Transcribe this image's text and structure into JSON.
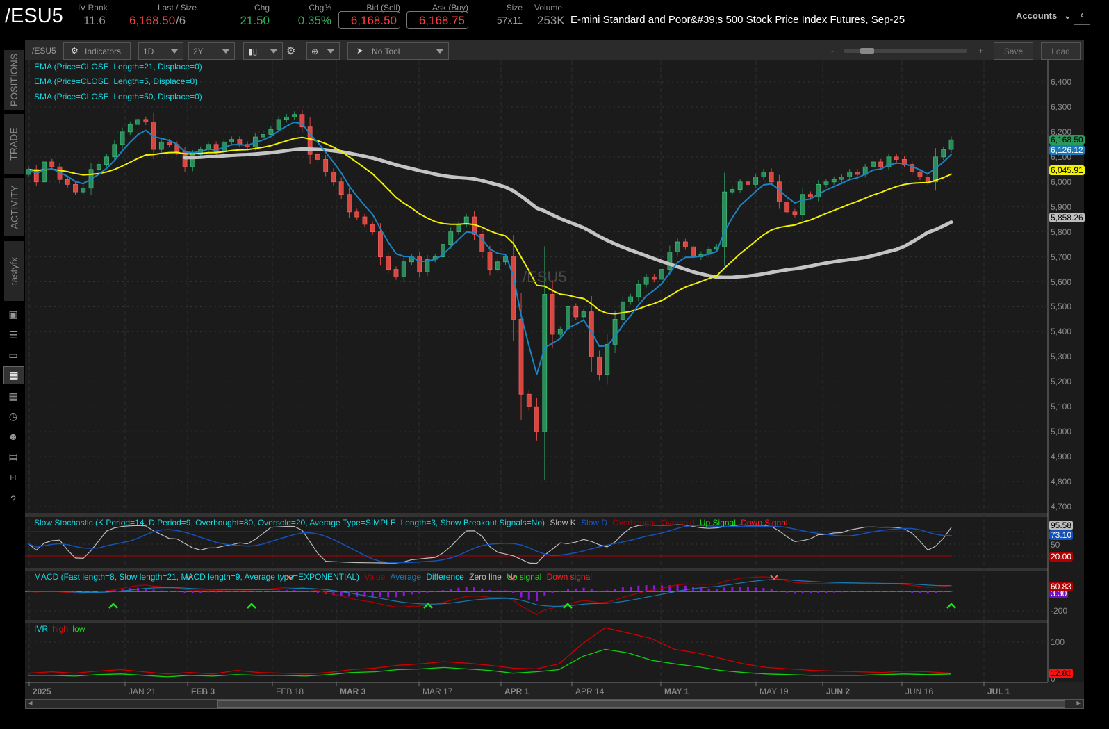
{
  "header": {
    "symbol": "/ESU5",
    "iv_rank": {
      "label": "IV Rank",
      "value": "11.6"
    },
    "last_size": {
      "label": "Last / Size",
      "last": "6,168.50",
      "size": "/6"
    },
    "chg": {
      "label": "Chg",
      "value": "21.50"
    },
    "chg_pct": {
      "label": "Chg%",
      "value": "0.35%"
    },
    "bid": {
      "label": "Bid (Sell)",
      "value": "6,168.50"
    },
    "ask": {
      "label": "Ask (Buy)",
      "value": "6,168.75"
    },
    "size": {
      "label": "Size",
      "value": "57x11"
    },
    "volume": {
      "label": "Volume",
      "value": "253K"
    },
    "description": "E-mini Standard and Poor&#39;s 500 Stock Price Index Futures, Sep-25",
    "accounts": "Accounts"
  },
  "toolbar": {
    "symbol": "/ESU5",
    "indicators": "Indicators",
    "interval": "1D",
    "range": "2Y",
    "tool": "No Tool",
    "zoom_minus": "-",
    "zoom_plus": "+",
    "zoom_level": 0.15,
    "save": "Save",
    "load": "Load"
  },
  "sidebar": {
    "tabs": [
      "POSITIONS",
      "TRADE",
      "ACTIVITY",
      "tastyfx"
    ]
  },
  "studies": {
    "ema21": "EMA (Price=CLOSE, Length=21, Displace=0)",
    "ema5": "EMA (Price=CLOSE, Length=5, Displace=0)",
    "sma50": "SMA (Price=CLOSE, Length=50, Displace=0)",
    "stoch": "Slow Stochastic (K Period=14, D Period=9, Overbought=80, Oversold=20, Average Type=SIMPLE, Length=3, Show Breakout Signals=No)",
    "stoch_series": [
      "Slow K",
      "Slow D",
      "Overbought",
      "Oversold",
      "Up Signal",
      "Down Signal"
    ],
    "macd": "MACD (Fast length=8, Slow length=21, MACD length=9, Average type=EXPONENTIAL)",
    "macd_series": [
      "Value",
      "Average",
      "Difference",
      "Zero line",
      "Up signal",
      "Down signal"
    ],
    "ivr": "IVR",
    "ivr_series": [
      "high",
      "low"
    ]
  },
  "watermark": "/ESU5",
  "colors": {
    "up": "#2b8c5a",
    "down": "#d9463f",
    "ema5": "#1b84c4",
    "ema21": "#f2f200",
    "sma50": "#c4c4c4",
    "cyan": "#19d8e0"
  },
  "chart_data": {
    "type": "candlestick",
    "price_axis": {
      "min": 4700,
      "max": 6400,
      "ticks": [
        "6,400",
        "6,300",
        "6,200",
        "6,100",
        "6,000",
        "5,900",
        "5,800",
        "5,700",
        "5,600",
        "5,500",
        "5,400",
        "5,300",
        "5,200",
        "5,100",
        "5,000",
        "4,900",
        "4,800",
        "4,700"
      ]
    },
    "date_ticks": [
      {
        "label": "2025",
        "bold": true
      },
      {
        "label": "JAN 21",
        "bold": false
      },
      {
        "label": "FEB 3",
        "bold": true
      },
      {
        "label": "FEB 18",
        "bold": false
      },
      {
        "label": "MAR 3",
        "bold": true
      },
      {
        "label": "MAR 17",
        "bold": false
      },
      {
        "label": "APR 1",
        "bold": true
      },
      {
        "label": "APR 14",
        "bold": false
      },
      {
        "label": "MAY 1",
        "bold": true
      },
      {
        "label": "MAY 19",
        "bold": false
      },
      {
        "label": "JUN 2",
        "bold": true
      },
      {
        "label": "JUN 16",
        "bold": false
      },
      {
        "label": "JUL 1",
        "bold": true
      }
    ],
    "close": [
      6050,
      6000,
      6080,
      6060,
      6010,
      5990,
      5960,
      5975,
      6050,
      6070,
      6100,
      6150,
      6200,
      6230,
      6250,
      6240,
      6130,
      6160,
      6150,
      6120,
      6060,
      6110,
      6130,
      6150,
      6120,
      6160,
      6170,
      6150,
      6140,
      6180,
      6190,
      6210,
      6250,
      6260,
      6270,
      6220,
      6110,
      6090,
      6040,
      6000,
      5950,
      5880,
      5860,
      5830,
      5800,
      5700,
      5650,
      5620,
      5680,
      5700,
      5640,
      5690,
      5700,
      5750,
      5800,
      5830,
      5860,
      5790,
      5720,
      5650,
      5680,
      5700,
      5450,
      5150,
      5100,
      5000,
      5550,
      5390,
      5410,
      5500,
      5460,
      5480,
      5300,
      5230,
      5350,
      5450,
      5520,
      5540,
      5590,
      5620,
      5610,
      5650,
      5720,
      5760,
      5740,
      5700,
      5710,
      5730,
      5740,
      5960,
      5970,
      6000,
      5990,
      6020,
      6040,
      6000,
      5920,
      5880,
      5870,
      5950,
      5940,
      5990,
      6000,
      6010,
      6020,
      6040,
      6030,
      6060,
      6080,
      6060,
      6100,
      6090,
      6070,
      6040,
      6020,
      6000,
      6100,
      6130,
      6168.5
    ],
    "last_values": {
      "last": "6,168.50",
      "ema5": "6,126.12",
      "ema21": "6,045.91",
      "sma50": "5,858.26"
    },
    "stoch": {
      "ticks": [
        "50"
      ],
      "overbought": 80,
      "oversold": 20,
      "slow_k": "95.58",
      "slow_d": "73.10",
      "oversold_label": "20.00"
    },
    "macd": {
      "ticks": [
        "-200"
      ],
      "value": "60.83",
      "diff": "3.30"
    },
    "ivr": {
      "ticks": [
        "100",
        "0"
      ],
      "last": "12.81",
      "high": [
        14,
        18,
        14,
        20,
        24,
        18,
        12,
        16,
        12,
        22,
        16,
        14,
        12,
        16,
        24,
        28,
        36,
        40,
        46,
        42,
        36,
        28,
        26,
        40,
        95,
        140,
        125,
        110,
        80,
        70,
        55,
        40,
        30,
        26,
        22,
        20,
        18,
        16,
        20,
        18,
        14
      ],
      "low": [
        8,
        8,
        6,
        10,
        12,
        8,
        4,
        8,
        6,
        10,
        8,
        8,
        6,
        10,
        16,
        18,
        24,
        26,
        30,
        26,
        22,
        14,
        18,
        24,
        60,
        80,
        70,
        50,
        40,
        32,
        22,
        16,
        12,
        10,
        8,
        8,
        8,
        10,
        12,
        10,
        12
      ]
    }
  }
}
